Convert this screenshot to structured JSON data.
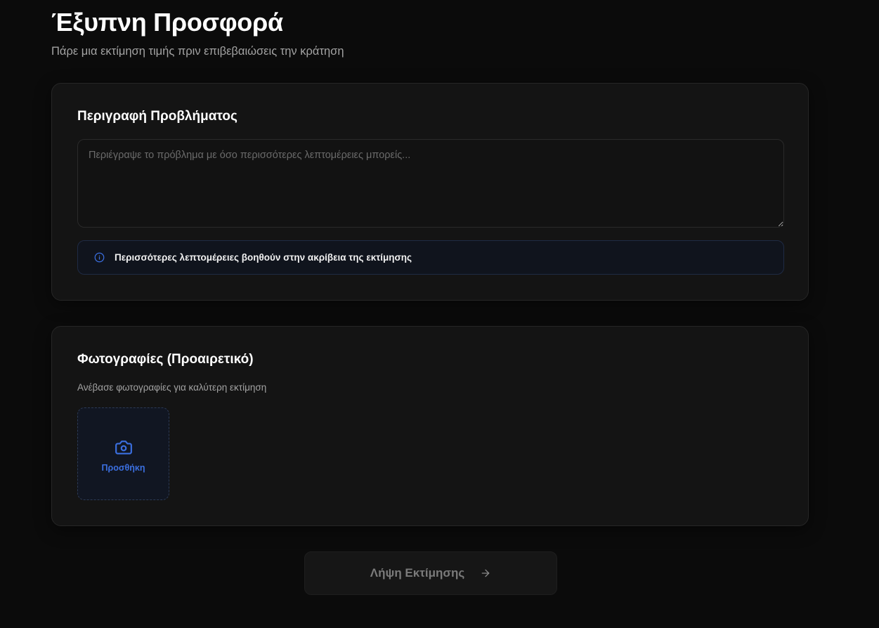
{
  "header": {
    "title": "Έξυπνη Προσφορά",
    "subtitle": "Πάρε μια εκτίμηση τιμής πριν επιβεβαιώσεις την κράτηση"
  },
  "description_card": {
    "heading": "Περιγραφή Προβλήματος",
    "textarea": {
      "value": "",
      "placeholder": "Περιέγραψε το πρόβλημα με όσο περισσότερες λεπτομέρειες μπορείς..."
    },
    "info": {
      "icon": "info-icon",
      "text": "Περισσότερες λεπτομέρειες βοηθούν στην ακρίβεια της εκτίμησης"
    }
  },
  "photos_card": {
    "heading": "Φωτογραφίες (Προαιρετικό)",
    "hint": "Ανέβασε φωτογραφίες για καλύτερη εκτίμηση",
    "upload": {
      "icon": "camera-icon",
      "label": "Προσθήκη"
    }
  },
  "submit": {
    "label": "Λήψη Εκτίμησης",
    "icon": "arrow-right-icon",
    "enabled": false
  },
  "colors": {
    "background": "#0b0b0b",
    "card": "#141414",
    "accent": "#3b6fe0",
    "muted_text": "#a3a3a3"
  }
}
